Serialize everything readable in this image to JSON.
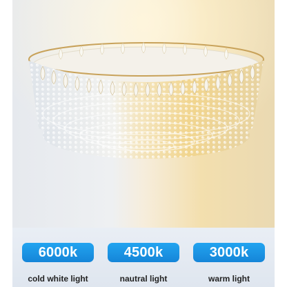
{
  "product": {
    "image_alt": "round crystal ceiling chandelier",
    "colors": {
      "cold": "#eef3fa",
      "neutral": "#f6ecd6",
      "warm": "#f2dba2",
      "badge": "#1e96e8"
    }
  },
  "color_temps": [
    {
      "value": "6000k",
      "label": "cold white light"
    },
    {
      "value": "4500k",
      "label": "nautral light"
    },
    {
      "value": "3000k",
      "label": "warm light"
    }
  ]
}
